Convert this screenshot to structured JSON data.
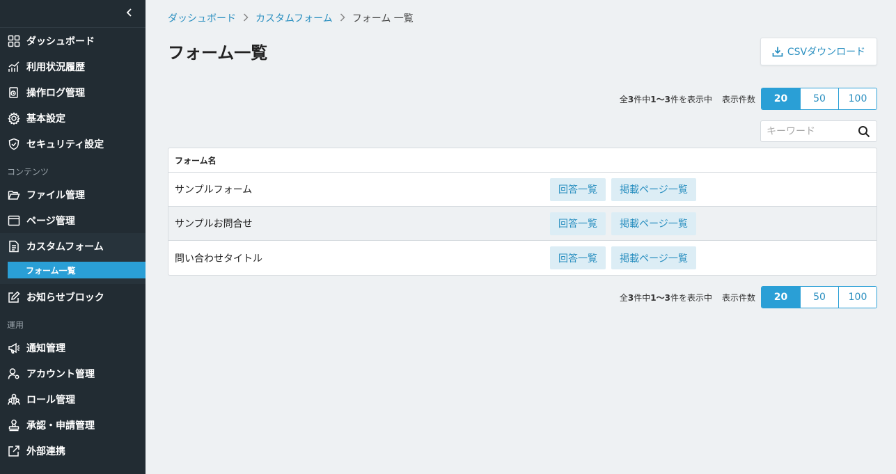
{
  "sidebar": {
    "items_top": [
      {
        "label": "ダッシュボード",
        "icon": "grid-icon"
      },
      {
        "label": "利用状況履歴",
        "icon": "chart-line-icon"
      },
      {
        "label": "操作ログ管理",
        "icon": "log-icon"
      },
      {
        "label": "基本設定",
        "icon": "gear-icon"
      },
      {
        "label": "セキュリティ設定",
        "icon": "shield-icon"
      }
    ],
    "section_contents": "コンテンツ",
    "items_contents": [
      {
        "label": "ファイル管理",
        "icon": "folder-icon"
      },
      {
        "label": "ページ管理",
        "icon": "window-icon"
      },
      {
        "label": "カスタムフォーム",
        "icon": "form-icon"
      }
    ],
    "sub_active": "フォーム一覧",
    "item_notice": {
      "label": "お知らせブロック",
      "icon": "edit-icon"
    },
    "section_ops": "運用",
    "items_ops": [
      {
        "label": "通知管理",
        "icon": "megaphone-icon"
      },
      {
        "label": "アカウント管理",
        "icon": "user-gear-icon"
      },
      {
        "label": "ロール管理",
        "icon": "users-icon"
      },
      {
        "label": "承認・申請管理",
        "icon": "stamp-icon"
      },
      {
        "label": "外部連携",
        "icon": "external-link-icon"
      }
    ]
  },
  "breadcrumb": {
    "link1": "ダッシュボード",
    "link2": "カスタムフォーム",
    "current": "フォーム 一覧"
  },
  "page_title": "フォーム一覧",
  "csv_button": "CSVダウンロード",
  "pager": {
    "count_prefix": "全",
    "total": "3",
    "count_mid": "件中",
    "range": "1〜3",
    "count_suffix": "件を表示中",
    "per_page_label": "表示件数",
    "options": [
      "20",
      "50",
      "100"
    ],
    "selected": "20"
  },
  "search": {
    "placeholder": "キーワード"
  },
  "table": {
    "header": "フォーム名",
    "rows": [
      {
        "name": "サンプルフォーム",
        "btn_answers": "回答一覧",
        "btn_pages": "掲載ページ一覧"
      },
      {
        "name": "サンプルお問合せ",
        "btn_answers": "回答一覧",
        "btn_pages": "掲載ページ一覧"
      },
      {
        "name": "問い合わせタイトル",
        "btn_answers": "回答一覧",
        "btn_pages": "掲載ページ一覧"
      }
    ]
  },
  "colors": {
    "accent": "#2a9fd6",
    "sidebar_bg": "#222c33",
    "page_bg": "#eef1f3"
  }
}
